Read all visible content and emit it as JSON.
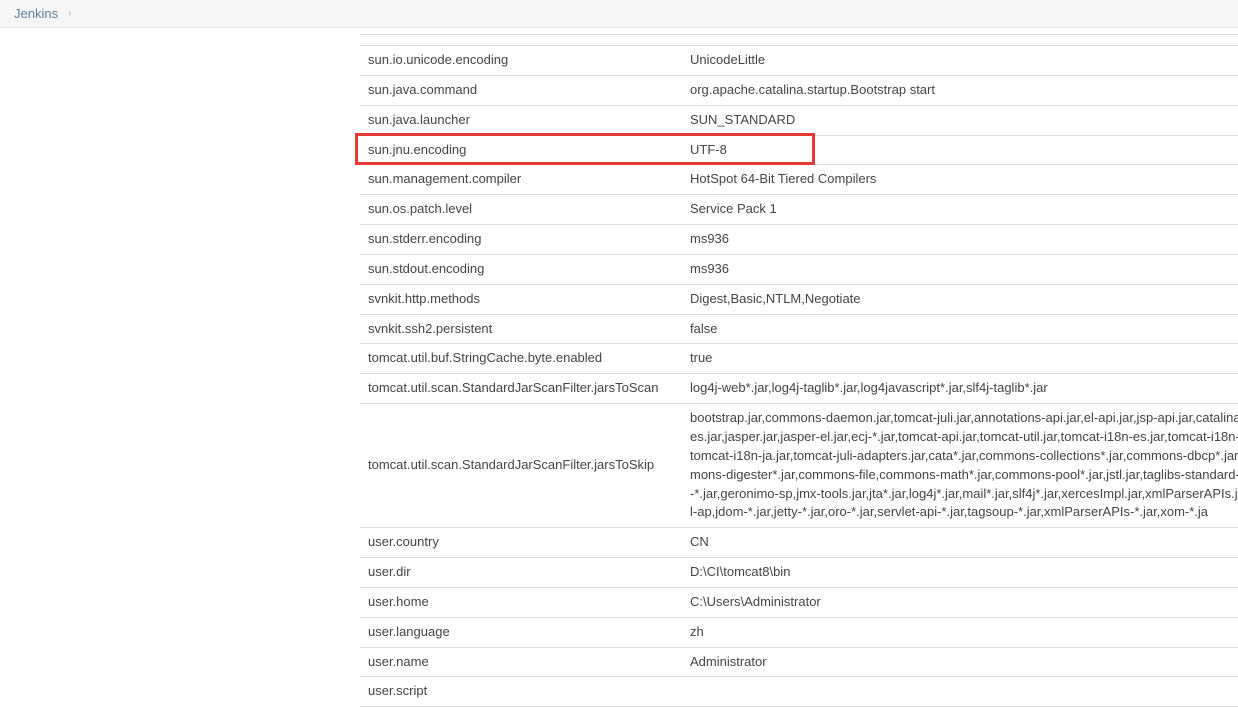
{
  "breadcrumb": {
    "root": "Jenkins",
    "sep": "›"
  },
  "highlight_key": "sun.jnu.encoding",
  "rows": [
    {
      "k": "",
      "v": ""
    },
    {
      "k": "sun.io.unicode.encoding",
      "v": "UnicodeLittle"
    },
    {
      "k": "sun.java.command",
      "v": "org.apache.catalina.startup.Bootstrap start"
    },
    {
      "k": "sun.java.launcher",
      "v": "SUN_STANDARD"
    },
    {
      "k": "sun.jnu.encoding",
      "v": "UTF-8"
    },
    {
      "k": "sun.management.compiler",
      "v": "HotSpot 64-Bit Tiered Compilers"
    },
    {
      "k": "sun.os.patch.level",
      "v": "Service Pack 1"
    },
    {
      "k": "sun.stderr.encoding",
      "v": "ms936"
    },
    {
      "k": "sun.stdout.encoding",
      "v": "ms936"
    },
    {
      "k": "svnkit.http.methods",
      "v": "Digest,Basic,NTLM,Negotiate"
    },
    {
      "k": "svnkit.ssh2.persistent",
      "v": "false"
    },
    {
      "k": "tomcat.util.buf.StringCache.byte.enabled",
      "v": "true"
    },
    {
      "k": "tomcat.util.scan.StandardJarScanFilter.jarsToScan",
      "v": "log4j-web*.jar,log4j-taglib*.jar,log4javascript*.jar,slf4j-taglib*.jar"
    },
    {
      "k": "tomcat.util.scan.StandardJarScanFilter.jarsToSkip",
      "v": "bootstrap.jar,commons-daemon.jar,tomcat-juli.jar,annotations-api.jar,el-api.jar,jsp-api.jar,catalina-tribes.jar,jasper.jar,jasper-el.jar,ecj-*.jar,tomcat-api.jar,tomcat-util.jar,tomcat-i18n-es.jar,tomcat-i18n-fr.jar,tomcat-i18n-ja.jar,tomcat-juli-adapters.jar,cata*.jar,commons-collections*.jar,commons-dbcp*.jar,commons-digester*.jar,commons-file,commons-math*.jar,commons-pool*.jar,jstl.jar,taglibs-standard-spec-*.jar,geronimo-sp,jmx-tools.jar,jta*.jar,log4j*.jar,mail*.jar,slf4j*.jar,xercesImpl.jar,xmlParserAPIs.jar,xml-ap,jdom-*.jar,jetty-*.jar,oro-*.jar,servlet-api-*.jar,tagsoup-*.jar,xmlParserAPIs-*.jar,xom-*.ja"
    },
    {
      "k": "user.country",
      "v": "CN"
    },
    {
      "k": "user.dir",
      "v": "D:\\CI\\tomcat8\\bin"
    },
    {
      "k": "user.home",
      "v": "C:\\Users\\Administrator"
    },
    {
      "k": "user.language",
      "v": "zh"
    },
    {
      "k": "user.name",
      "v": "Administrator"
    },
    {
      "k": "user.script",
      "v": ""
    }
  ]
}
